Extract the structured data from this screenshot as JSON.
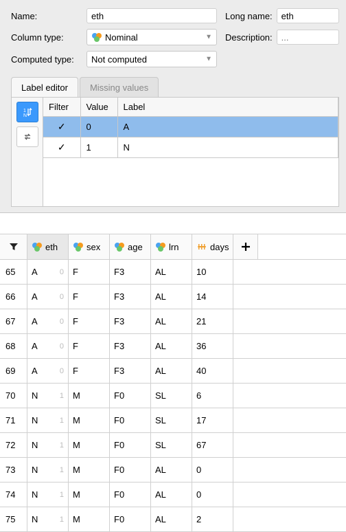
{
  "form": {
    "name_label": "Name:",
    "name_value": "eth",
    "longname_label": "Long name:",
    "longname_value": "eth",
    "coltype_label": "Column type:",
    "coltype_value": "Nominal",
    "desc_label": "Description:",
    "desc_placeholder": "...",
    "comptype_label": "Computed type:",
    "comptype_value": "Not computed"
  },
  "tabs": {
    "label_editor": "Label editor",
    "missing_values": "Missing values"
  },
  "le": {
    "h_filter": "Filter",
    "h_value": "Value",
    "h_label": "Label",
    "rows": [
      {
        "filter": "✓",
        "value": "0",
        "label": "A"
      },
      {
        "filter": "✓",
        "value": "1",
        "label": "N"
      }
    ]
  },
  "grid": {
    "cols": [
      "eth",
      "sex",
      "age",
      "lrn",
      "days"
    ],
    "col_types": [
      "nominal",
      "nominal",
      "nominal",
      "nominal",
      "scale"
    ],
    "rows": [
      {
        "n": "65",
        "eth": "A",
        "ethc": "0",
        "sex": "F",
        "age": "F3",
        "lrn": "AL",
        "days": "10"
      },
      {
        "n": "66",
        "eth": "A",
        "ethc": "0",
        "sex": "F",
        "age": "F3",
        "lrn": "AL",
        "days": "14"
      },
      {
        "n": "67",
        "eth": "A",
        "ethc": "0",
        "sex": "F",
        "age": "F3",
        "lrn": "AL",
        "days": "21"
      },
      {
        "n": "68",
        "eth": "A",
        "ethc": "0",
        "sex": "F",
        "age": "F3",
        "lrn": "AL",
        "days": "36"
      },
      {
        "n": "69",
        "eth": "A",
        "ethc": "0",
        "sex": "F",
        "age": "F3",
        "lrn": "AL",
        "days": "40"
      },
      {
        "n": "70",
        "eth": "N",
        "ethc": "1",
        "sex": "M",
        "age": "F0",
        "lrn": "SL",
        "days": "6"
      },
      {
        "n": "71",
        "eth": "N",
        "ethc": "1",
        "sex": "M",
        "age": "F0",
        "lrn": "SL",
        "days": "17"
      },
      {
        "n": "72",
        "eth": "N",
        "ethc": "1",
        "sex": "M",
        "age": "F0",
        "lrn": "SL",
        "days": "67"
      },
      {
        "n": "73",
        "eth": "N",
        "ethc": "1",
        "sex": "M",
        "age": "F0",
        "lrn": "AL",
        "days": "0"
      },
      {
        "n": "74",
        "eth": "N",
        "ethc": "1",
        "sex": "M",
        "age": "F0",
        "lrn": "AL",
        "days": "0"
      },
      {
        "n": "75",
        "eth": "N",
        "ethc": "1",
        "sex": "M",
        "age": "F0",
        "lrn": "AL",
        "days": "2"
      }
    ]
  }
}
